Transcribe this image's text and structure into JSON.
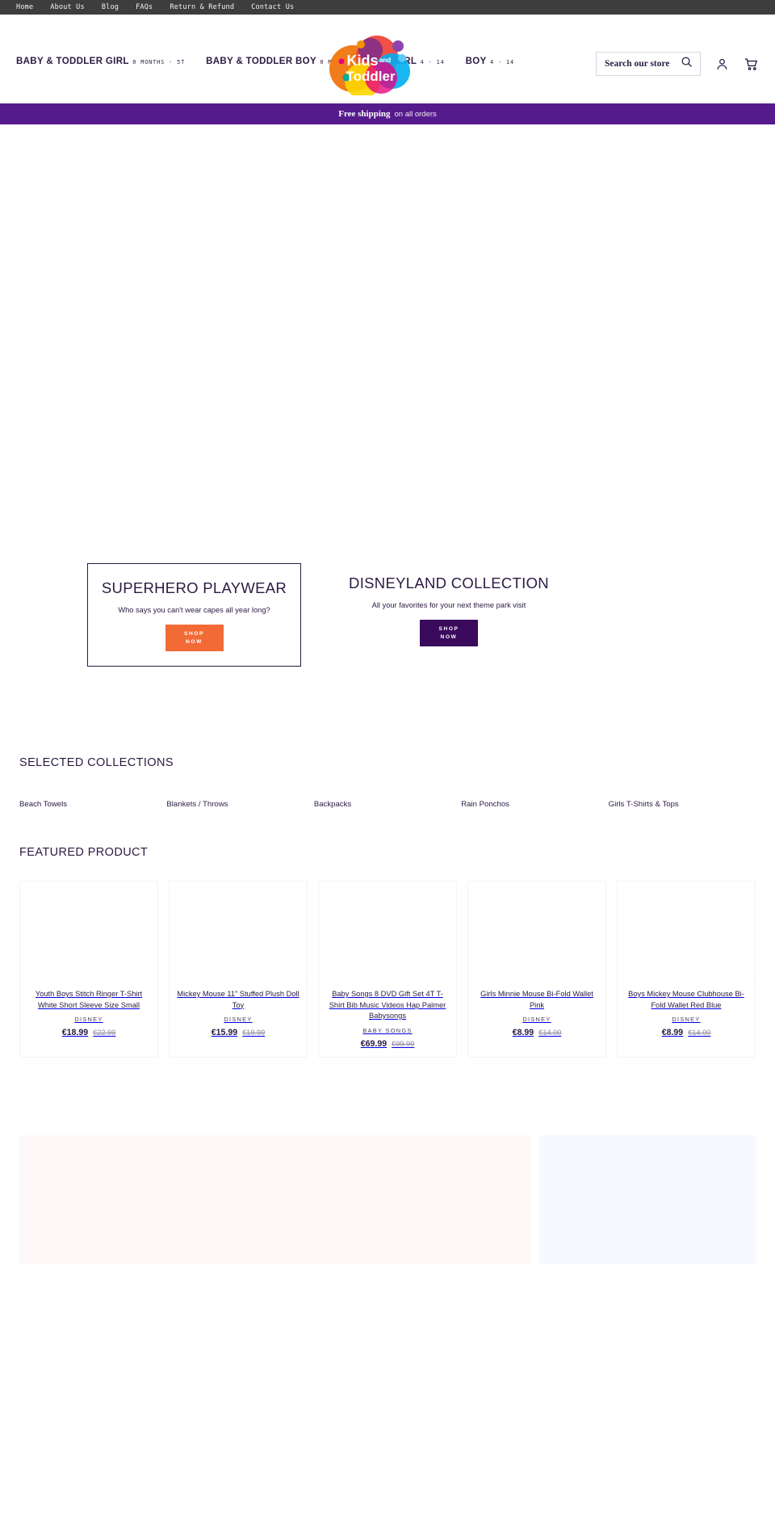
{
  "topbar": {
    "links": [
      {
        "label": "Home"
      },
      {
        "label": "About Us"
      },
      {
        "label": "Blog"
      },
      {
        "label": "FAQs"
      },
      {
        "label": "Return & Refund"
      },
      {
        "label": "Contact Us"
      }
    ]
  },
  "header": {
    "nav": [
      {
        "title": "BABY & TODDLER GIRL",
        "sub": "0 MONTHS - 5T"
      },
      {
        "title": "BABY & TODDLER BOY",
        "sub": "0 MONTHS - 5T"
      },
      {
        "title": "GIRL",
        "sub": "4 - 14"
      },
      {
        "title": "BOY",
        "sub": "4 - 14"
      }
    ],
    "logo": {
      "line1": "Kids",
      "and": "and",
      "line2": "Toddler"
    },
    "search": {
      "placeholder": "Search our store",
      "value": ""
    },
    "account_label": "Account",
    "cart_label": "Cart"
  },
  "announcement": {
    "bold": "Free shipping",
    "normal": "on all orders"
  },
  "hero": {
    "promos": [
      {
        "heading": "SUPERHERO PLAYWEAR",
        "subheading": "Who says you can't wear capes all year long?",
        "button_line1": "SHOP",
        "button_line2": "NOW",
        "button_color": "#f26a35"
      },
      {
        "heading": "DISNEYLAND COLLECTION",
        "subheading": "All your favorites for your next theme park visit",
        "button_line1": "SHOP",
        "button_line2": "NOW",
        "button_color": "#3a0a5c"
      }
    ]
  },
  "collections_section": {
    "title": "SELECTED COLLECTIONS",
    "items": [
      {
        "label": "Beach Towels"
      },
      {
        "label": "Blankets / Throws"
      },
      {
        "label": "Backpacks"
      },
      {
        "label": "Rain Ponchos"
      },
      {
        "label": "Girls T-Shirts & Tops"
      }
    ]
  },
  "featured_section": {
    "title": "FEATURED PRODUCT",
    "products": [
      {
        "title": "Youth Boys Stitch Ringer T-Shirt White Short Sleeve Size Small",
        "vendor": "DISNEY",
        "price": "€18.99",
        "compare_at": "€22.99"
      },
      {
        "title": "Mickey Mouse 11\" Stuffed Plush Doll Toy",
        "vendor": "DISNEY",
        "price": "€15.99",
        "compare_at": "€19.99"
      },
      {
        "title": "Baby Songs 8 DVD Gift Set 4T T-Shirt Bib Music Videos Hap Palmer Babysongs",
        "vendor": "BABY SONGS",
        "price": "€69.99",
        "compare_at": "€99.99"
      },
      {
        "title": "Girls Minnie Mouse Bi-Fold Wallet Pink",
        "vendor": "DISNEY",
        "price": "€8.99",
        "compare_at": "€14.00"
      },
      {
        "title": "Boys Mickey Mouse Clubhouse Bi-Fold Wallet Red Blue",
        "vendor": "DISNEY",
        "price": "€8.99",
        "compare_at": "€14.00"
      }
    ]
  },
  "colors": {
    "announcement_bg": "#551a8b",
    "topbar_bg": "#3d3d3d",
    "text": "#2b1a43",
    "accent_orange": "#f26a35",
    "accent_purple": "#3a0a5c",
    "panel_pink": "#fef9f8",
    "panel_blue": "#f6f9fe"
  }
}
